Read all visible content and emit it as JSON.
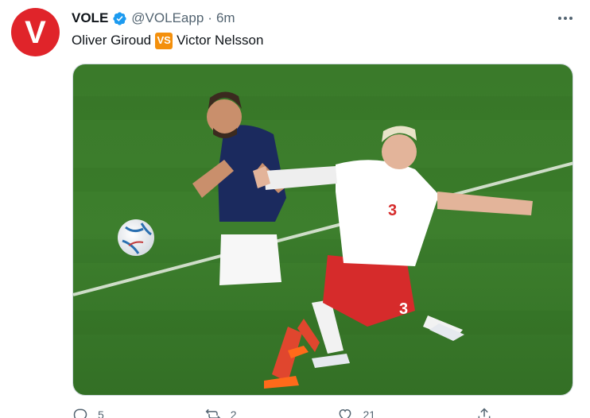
{
  "author": {
    "display_name": "VOLE",
    "handle": "@VOLEapp",
    "separator": "·",
    "time": "6m",
    "avatar_letter": "V",
    "avatar_color": "#e0242a",
    "verified": true
  },
  "tweet": {
    "text_before": "Oliver Giroud",
    "vs_emoji": "VS",
    "text_after": "Victor Nelsson"
  },
  "media": {
    "pitch_color": "#3c7a2b",
    "player_left_shirt": "#1b2a5e",
    "player_right_shirt": "#ffffff",
    "player_right_number": "3",
    "player_right_shorts": "#d62b2b"
  },
  "actions": {
    "reply_count": "5",
    "retweet_count": "2",
    "like_count": "21",
    "share_label": ""
  },
  "colors": {
    "verified_blue": "#1d9bf0",
    "secondary_text": "#536471",
    "vs_badge": "#f4900c"
  }
}
